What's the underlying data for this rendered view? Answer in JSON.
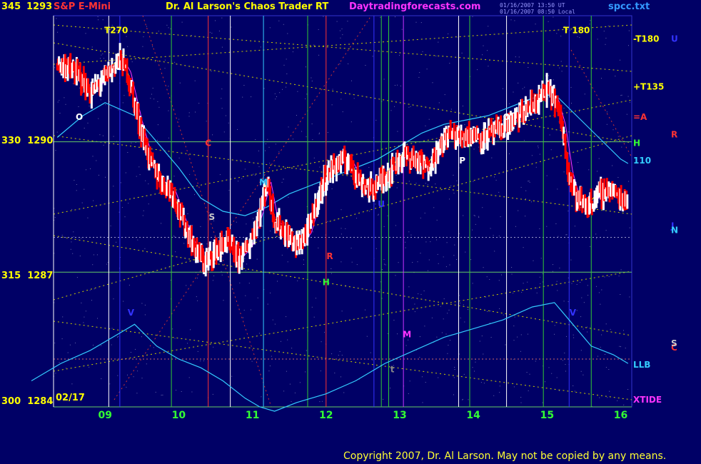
{
  "header": {
    "symbol_left": "345",
    "symbol_price": "1293",
    "instrument": "S&P E-Mini",
    "title": "Dr. Al Larson's Chaos Trader RT",
    "site": "Daytradingforecasts.com",
    "stamp_1": "01/16/2007 13:50 UT",
    "stamp_2": "01/16/2007 08:50 Local",
    "file": "spcc.txt"
  },
  "footer": {
    "date_label": "02/17",
    "copyright": "Copyright 2007, Dr. Al Larson. May not be copied by any means."
  },
  "colors": {
    "background": "#000066",
    "price_up": "#ffffff",
    "price_down": "#ff0000",
    "grid_h": "#66cc66",
    "vline_white": "#ffffff",
    "vline_green": "#33cc33",
    "vline_red": "#ff3333",
    "vline_cyan": "#33ccff",
    "vline_magenta": "#cc33ff",
    "vline_blue": "#3333ff",
    "ema_cyan": "#33ccff",
    "ma_yellow": "#ffff00",
    "ma_magenta": "#ff33ff",
    "dotted_yellow": "#cccc00",
    "dotted_red": "#cc3333"
  },
  "chart_data": {
    "type": "line",
    "title": "S&P E-Mini",
    "x_tick_labels": [
      "09",
      "10",
      "11",
      "12",
      "13",
      "14",
      "15",
      "16"
    ],
    "y_axis_labels": [
      {
        "deg": "345",
        "price": "1293"
      },
      {
        "deg": "330",
        "price": "1290"
      },
      {
        "deg": "315",
        "price": "1287"
      },
      {
        "deg": "300",
        "price": "1284"
      }
    ],
    "ylim": [
      1284,
      1293
    ],
    "xlim": [
      8.3,
      16.15
    ],
    "price_series": [
      [
        8.35,
        1291.9
      ],
      [
        8.5,
        1291.8
      ],
      [
        8.65,
        1291.6
      ],
      [
        8.8,
        1291.2
      ],
      [
        8.95,
        1291.5
      ],
      [
        9.1,
        1291.8
      ],
      [
        9.2,
        1292.0
      ],
      [
        9.3,
        1291.7
      ],
      [
        9.45,
        1290.6
      ],
      [
        9.6,
        1289.7
      ],
      [
        9.75,
        1289.2
      ],
      [
        9.9,
        1289.0
      ],
      [
        10.05,
        1288.3
      ],
      [
        10.2,
        1287.7
      ],
      [
        10.35,
        1287.3
      ],
      [
        10.5,
        1287.6
      ],
      [
        10.65,
        1287.8
      ],
      [
        10.8,
        1287.4
      ],
      [
        10.95,
        1287.7
      ],
      [
        11.1,
        1288.5
      ],
      [
        11.2,
        1289.2
      ],
      [
        11.3,
        1288.3
      ],
      [
        11.45,
        1288.0
      ],
      [
        11.6,
        1287.7
      ],
      [
        11.75,
        1288.0
      ],
      [
        11.85,
        1288.6
      ],
      [
        12.0,
        1289.3
      ],
      [
        12.15,
        1289.6
      ],
      [
        12.3,
        1289.7
      ],
      [
        12.45,
        1289.2
      ],
      [
        12.6,
        1289.0
      ],
      [
        12.75,
        1289.2
      ],
      [
        12.9,
        1289.5
      ],
      [
        13.05,
        1289.8
      ],
      [
        13.2,
        1289.7
      ],
      [
        13.35,
        1289.5
      ],
      [
        13.5,
        1289.8
      ],
      [
        13.65,
        1290.3
      ],
      [
        13.8,
        1290.2
      ],
      [
        13.95,
        1290.3
      ],
      [
        14.1,
        1290.2
      ],
      [
        14.25,
        1290.3
      ],
      [
        14.4,
        1290.4
      ],
      [
        14.55,
        1290.6
      ],
      [
        14.7,
        1290.8
      ],
      [
        14.85,
        1291.0
      ],
      [
        15.0,
        1291.3
      ],
      [
        15.1,
        1291.1
      ],
      [
        15.2,
        1290.5
      ],
      [
        15.3,
        1289.4
      ],
      [
        15.4,
        1288.8
      ],
      [
        15.55,
        1288.6
      ],
      [
        15.7,
        1288.9
      ],
      [
        15.85,
        1289.0
      ],
      [
        16.0,
        1288.8
      ],
      [
        16.1,
        1288.8
      ]
    ],
    "ema_upper": [
      [
        8.35,
        1290.2
      ],
      [
        8.7,
        1290.7
      ],
      [
        9.0,
        1291.0
      ],
      [
        9.4,
        1290.7
      ],
      [
        9.7,
        1290.1
      ],
      [
        10.0,
        1289.5
      ],
      [
        10.3,
        1288.8
      ],
      [
        10.6,
        1288.5
      ],
      [
        10.9,
        1288.4
      ],
      [
        11.2,
        1288.6
      ],
      [
        11.5,
        1288.9
      ],
      [
        11.8,
        1289.1
      ],
      [
        12.1,
        1289.3
      ],
      [
        12.4,
        1289.5
      ],
      [
        12.7,
        1289.7
      ],
      [
        13.0,
        1290.0
      ],
      [
        13.3,
        1290.3
      ],
      [
        13.6,
        1290.5
      ],
      [
        13.9,
        1290.6
      ],
      [
        14.2,
        1290.7
      ],
      [
        14.5,
        1290.9
      ],
      [
        14.8,
        1291.1
      ],
      [
        15.1,
        1291.2
      ],
      [
        15.4,
        1290.7
      ],
      [
        15.7,
        1290.2
      ],
      [
        16.0,
        1289.7
      ],
      [
        16.1,
        1289.6
      ]
    ],
    "ema_lower": [
      [
        8.0,
        1284.6
      ],
      [
        8.4,
        1285.0
      ],
      [
        8.8,
        1285.3
      ],
      [
        9.2,
        1285.7
      ],
      [
        9.4,
        1285.9
      ],
      [
        9.7,
        1285.4
      ],
      [
        10.0,
        1285.1
      ],
      [
        10.3,
        1284.9
      ],
      [
        10.6,
        1284.6
      ],
      [
        10.9,
        1284.2
      ],
      [
        11.1,
        1284.0
      ],
      [
        11.3,
        1283.9
      ],
      [
        11.6,
        1284.1
      ],
      [
        12.0,
        1284.3
      ],
      [
        12.4,
        1284.6
      ],
      [
        12.8,
        1285.0
      ],
      [
        13.2,
        1285.3
      ],
      [
        13.6,
        1285.6
      ],
      [
        14.0,
        1285.8
      ],
      [
        14.4,
        1286.0
      ],
      [
        14.8,
        1286.3
      ],
      [
        15.1,
        1286.4
      ],
      [
        15.3,
        1286.0
      ],
      [
        15.6,
        1285.4
      ],
      [
        15.9,
        1285.2
      ],
      [
        16.1,
        1285.0
      ]
    ],
    "vertical_markers": [
      {
        "x": 8.3,
        "color": "white"
      },
      {
        "x": 9.05,
        "color": "white"
      },
      {
        "x": 9.2,
        "color": "blue"
      },
      {
        "x": 9.9,
        "color": "green"
      },
      {
        "x": 10.4,
        "color": "red"
      },
      {
        "x": 10.7,
        "color": "white"
      },
      {
        "x": 11.15,
        "color": "cyan"
      },
      {
        "x": 11.75,
        "color": "green"
      },
      {
        "x": 12.0,
        "color": "red"
      },
      {
        "x": 12.65,
        "color": "blue"
      },
      {
        "x": 12.75,
        "color": "green"
      },
      {
        "x": 12.85,
        "color": "green"
      },
      {
        "x": 13.05,
        "color": "magenta"
      },
      {
        "x": 13.8,
        "color": "white"
      },
      {
        "x": 13.95,
        "color": "green"
      },
      {
        "x": 14.45,
        "color": "white"
      },
      {
        "x": 14.95,
        "color": "green"
      },
      {
        "x": 15.3,
        "color": "blue"
      },
      {
        "x": 15.6,
        "color": "green"
      }
    ],
    "horizontal_lines": [
      1290.1,
      1287.1,
      1284.0
    ],
    "annotations": [
      {
        "text": "T270",
        "x": 9.15,
        "y": 1292.6,
        "color": "#ffff00"
      },
      {
        "text": "T 180",
        "x": 15.4,
        "y": 1292.6,
        "color": "#ffff00"
      },
      {
        "text": "O",
        "x": 8.65,
        "y": 1290.6,
        "color": "#ffffff"
      },
      {
        "text": "O",
        "x": 14.45,
        "y": 1290.6,
        "color": "#ffffff"
      },
      {
        "text": "C",
        "x": 10.4,
        "y": 1290.0,
        "color": "#ff3333"
      },
      {
        "text": "S",
        "x": 10.45,
        "y": 1288.3,
        "color": "#cccccc"
      },
      {
        "text": "M",
        "x": 11.15,
        "y": 1289.1,
        "color": "#33ccff"
      },
      {
        "text": "U",
        "x": 12.75,
        "y": 1288.6,
        "color": "#3333ff"
      },
      {
        "text": "P",
        "x": 13.85,
        "y": 1289.6,
        "color": "#ffffff"
      },
      {
        "text": "R",
        "x": 12.05,
        "y": 1287.4,
        "color": "#ff3333"
      },
      {
        "text": "H",
        "x": 12.0,
        "y": 1286.8,
        "color": "#33ff33"
      },
      {
        "text": "V",
        "x": 9.35,
        "y": 1286.1,
        "color": "#3333ff"
      },
      {
        "text": "V",
        "x": 15.35,
        "y": 1286.1,
        "color": "#3333ff"
      },
      {
        "text": "M",
        "x": 13.1,
        "y": 1285.6,
        "color": "#ff33ff"
      },
      {
        "text": "t",
        "x": 12.9,
        "y": 1284.8,
        "color": "#888888"
      }
    ],
    "right_labels": [
      {
        "text": "-T180",
        "y": 1292.4,
        "color": "#ffff00"
      },
      {
        "text": "U",
        "y": 1292.4,
        "color": "#3333ff",
        "far": true
      },
      {
        "text": "+T135",
        "y": 1291.3,
        "color": "#ffff00"
      },
      {
        "text": "=A",
        "y": 1290.6,
        "color": "#ff3333"
      },
      {
        "text": "R",
        "y": 1290.2,
        "color": "#ff3333",
        "far": true
      },
      {
        "text": "H",
        "y": 1290.0,
        "color": "#33ff33"
      },
      {
        "text": "110",
        "y": 1289.6,
        "color": "#33ccff"
      },
      {
        "text": "J",
        "y": 1288.1,
        "color": "#3333ff",
        "far": true
      },
      {
        "text": "N",
        "y": 1288.0,
        "color": "#33ccff",
        "far": true
      },
      {
        "text": "C",
        "y": 1285.3,
        "color": "#ff3333",
        "far": true
      },
      {
        "text": "S",
        "y": 1285.4,
        "color": "#cccccc",
        "far": true
      },
      {
        "text": "LLB",
        "y": 1284.9,
        "color": "#33ccff"
      },
      {
        "text": "XTIDE",
        "y": 1284.1,
        "color": "#ff33ff"
      }
    ]
  }
}
